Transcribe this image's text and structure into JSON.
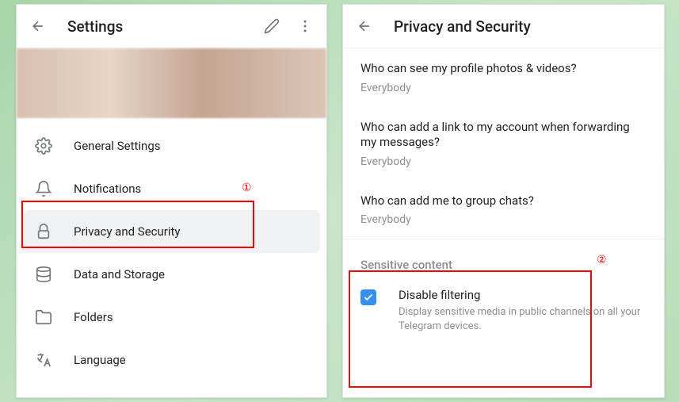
{
  "left_panel": {
    "title": "Settings",
    "menu": [
      {
        "icon": "gear",
        "label": "General Settings"
      },
      {
        "icon": "bell",
        "label": "Notifications"
      },
      {
        "icon": "lock",
        "label": "Privacy and Security"
      },
      {
        "icon": "database",
        "label": "Data and Storage"
      },
      {
        "icon": "folder",
        "label": "Folders"
      },
      {
        "icon": "language",
        "label": "Language"
      }
    ]
  },
  "right_panel": {
    "title": "Privacy and Security",
    "privacy_items": [
      {
        "title": "Who can see my profile photos & videos?",
        "value": "Everybody"
      },
      {
        "title": "Who can add a link to my account when forwarding my messages?",
        "value": "Everybody"
      },
      {
        "title": "Who can add me to group chats?",
        "value": "Everybody"
      }
    ],
    "sensitive_section": {
      "header": "Sensitive content",
      "checkbox_title": "Disable filtering",
      "checkbox_desc": "Display sensitive media in public channels on all your Telegram devices."
    }
  },
  "annotations": {
    "label1": "①",
    "label2": "②"
  }
}
